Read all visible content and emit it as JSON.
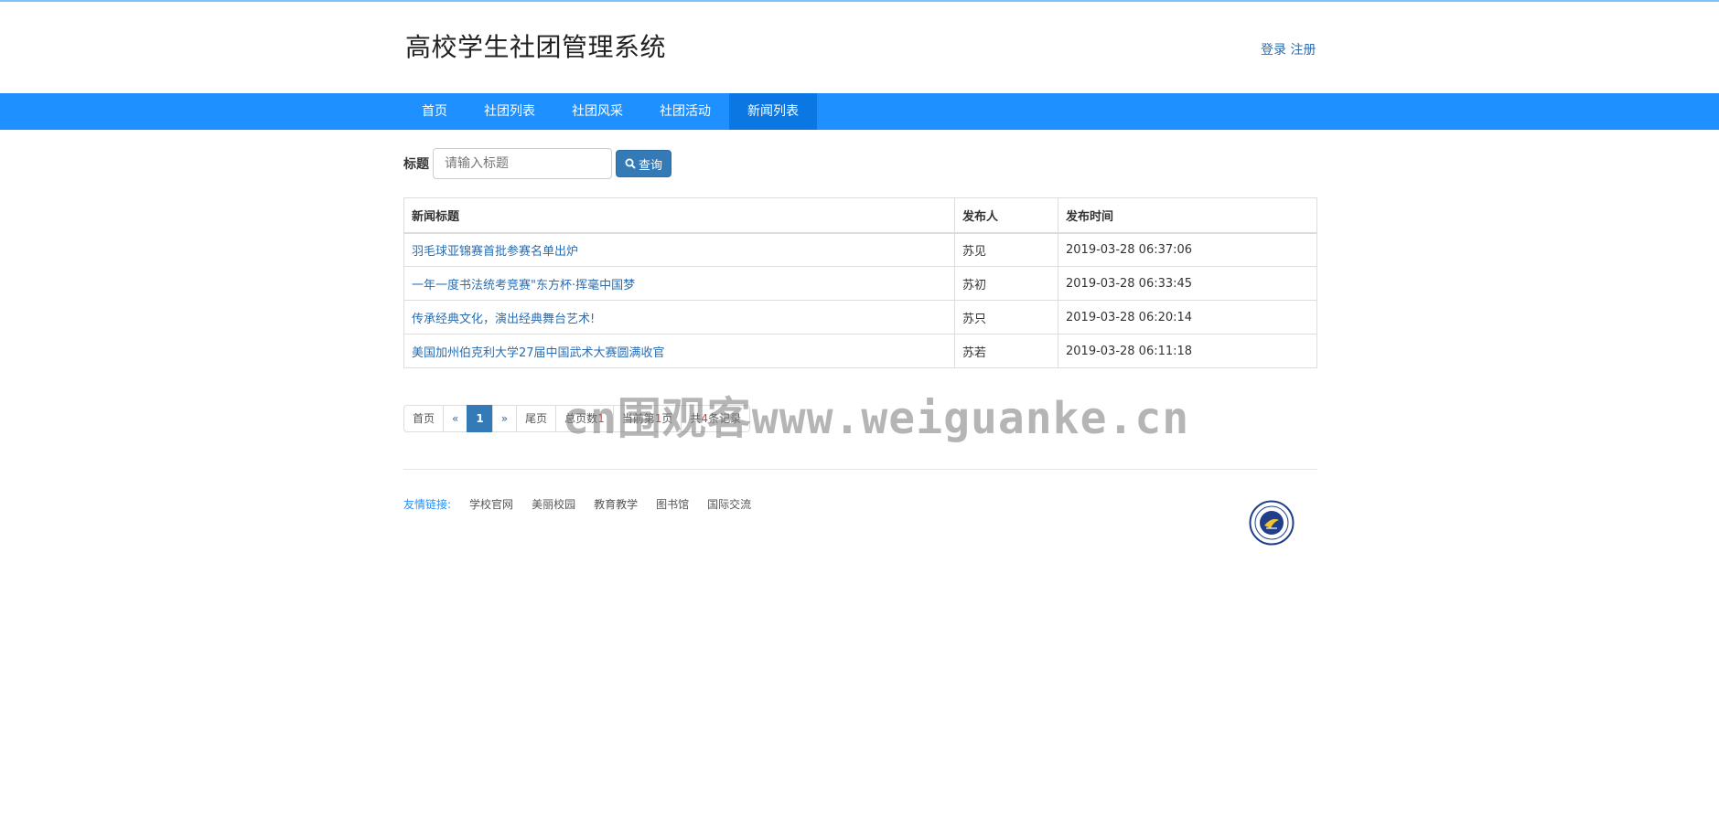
{
  "header": {
    "site_title": "高校学生社团管理系统",
    "login": "登录",
    "register": "注册"
  },
  "nav": {
    "items": [
      {
        "label": "首页"
      },
      {
        "label": "社团列表"
      },
      {
        "label": "社团风采"
      },
      {
        "label": "社团活动"
      },
      {
        "label": "新闻列表",
        "active": true
      }
    ]
  },
  "search": {
    "label": "标题",
    "placeholder": "请输入标题",
    "button_label": "查询"
  },
  "table": {
    "headers": [
      "新闻标题",
      "发布人",
      "发布时间"
    ],
    "rows": [
      {
        "title": "羽毛球亚锦赛首批参赛名单出炉",
        "author": "苏见",
        "time": "2019-03-28 06:37:06"
      },
      {
        "title": "一年一度书法统考竞赛\"东方杯·挥毫中国梦",
        "author": "苏初",
        "time": "2019-03-28 06:33:45"
      },
      {
        "title": "传承经典文化，演出经典舞台艺术!",
        "author": "苏只",
        "time": "2019-03-28 06:20:14"
      },
      {
        "title": "美国加州伯克利大学27届中国武术大赛圆满收官",
        "author": "苏若",
        "time": "2019-03-28 06:11:18"
      }
    ]
  },
  "pagination": {
    "first": "首页",
    "prev": "«",
    "current": "1",
    "next": "»",
    "last": "尾页",
    "total_pages_label": "总页数",
    "total_pages": "1",
    "current_page_prefix": "当前第",
    "current_page": "1",
    "current_page_suffix": "页",
    "records_prefix": "共",
    "records": "4",
    "records_suffix": "条记录"
  },
  "watermark": "cn围观客www.weiguanke.cn",
  "footer": {
    "links_label": "友情链接:",
    "links": [
      "学校官网",
      "美丽校园",
      "教育教学",
      "图书馆",
      "国际交流"
    ]
  },
  "colors": {
    "nav_bg": "#1e90ff",
    "nav_active": "#0b77e3",
    "link": "#2a6db0",
    "button": "#337ab7"
  }
}
